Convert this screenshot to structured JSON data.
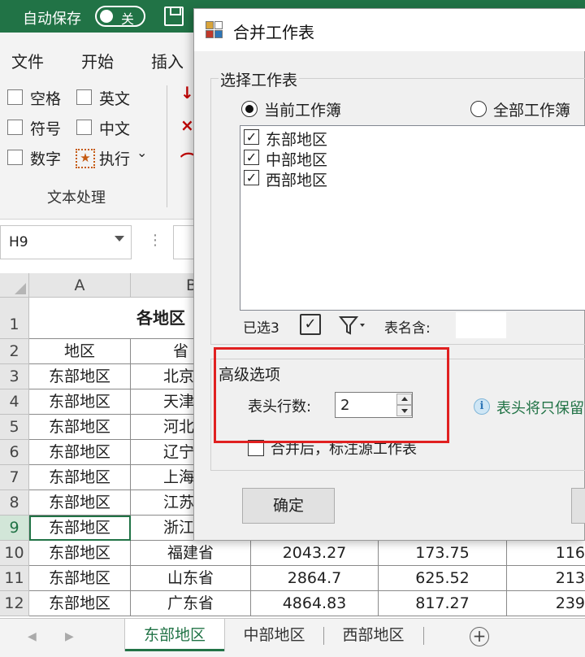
{
  "titlebar": {
    "autosave_label": "自动保存",
    "toggle_text": "关"
  },
  "menu": {
    "tabs": [
      "文件",
      "开始",
      "插入"
    ]
  },
  "ribbon": {
    "options": [
      "空格",
      "英文",
      "符号",
      "中文",
      "数字",
      "执行"
    ],
    "exec_dropdown": "⌄",
    "group_label": "文本处理"
  },
  "namebox": {
    "value": "H9"
  },
  "sheet": {
    "columns": [
      "A",
      "B"
    ],
    "row_numbers": [
      "1",
      "2",
      "3",
      "4",
      "5",
      "6",
      "7",
      "8",
      "9",
      "10",
      "11",
      "12"
    ],
    "title_partial": "各地区",
    "header": [
      "地区",
      "省"
    ],
    "rows": [
      [
        "东部地区",
        "北京"
      ],
      [
        "东部地区",
        "天津"
      ],
      [
        "东部地区",
        "河北"
      ],
      [
        "东部地区",
        "辽宁"
      ],
      [
        "东部地区",
        "上海"
      ],
      [
        "东部地区",
        "江苏"
      ],
      [
        "东部地区",
        "浙江"
      ],
      [
        "东部地区",
        "福建省",
        "2043.27",
        "173.75",
        "116"
      ],
      [
        "东部地区",
        "山东省",
        "2864.7",
        "625.52",
        "213"
      ],
      [
        "东部地区",
        "广东省",
        "4864.83",
        "817.27",
        "239"
      ]
    ]
  },
  "sheet_tabs": [
    "东部地区",
    "中部地区",
    "西部地区"
  ],
  "dialog": {
    "title": "合并工作表",
    "select_group_label": "选择工作表",
    "radio_current": "当前工作簿",
    "radio_all": "全部工作簿",
    "sheets": [
      "东部地区",
      "中部地区",
      "西部地区"
    ],
    "selected_count": "已选3",
    "name_contains_label": "表名含:",
    "advanced_label": "高级选项",
    "header_rows_label": "表头行数:",
    "header_rows_value": "2",
    "info_text": "表头将只保留",
    "note_label": "合并后，标注源工作表",
    "ok_label": "确定"
  }
}
